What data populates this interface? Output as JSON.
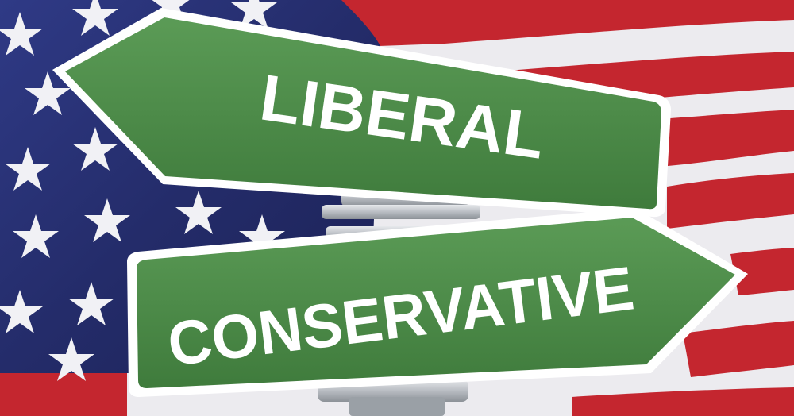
{
  "signs": {
    "upper": {
      "label": "LIBERAL"
    },
    "lower": {
      "label": "CONSERVATIVE"
    }
  },
  "colors": {
    "flag_blue": "#262e6e",
    "flag_red": "#c4262f",
    "flag_white": "#ecebef",
    "sign_green": "#4a8a46",
    "sign_border": "#ffffff",
    "bracket_metal": "#c9ccd1"
  }
}
